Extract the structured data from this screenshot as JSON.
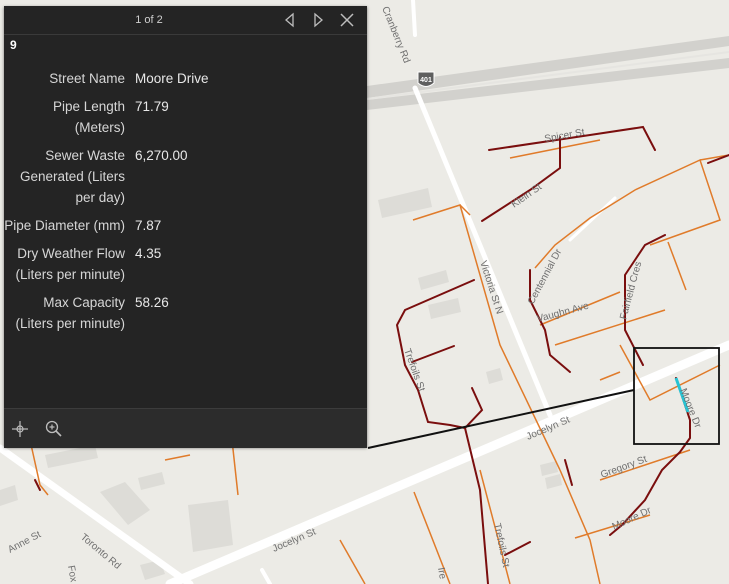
{
  "popup": {
    "pager_text": "1 of 2",
    "feature_id": "9",
    "attributes": [
      {
        "label": "Street Name",
        "value": "Moore Drive"
      },
      {
        "label": "Pipe Length (Meters)",
        "value": "71.79"
      },
      {
        "label": "Sewer Waste Generated (Liters per day)",
        "value": "6,270.00"
      },
      {
        "label": "Pipe Diameter (mm)",
        "value": "7.87"
      },
      {
        "label": "Dry Weather Flow (Liters per minute)",
        "value": "4.35"
      },
      {
        "label": "Max Capacity (Liters per minute)",
        "value": "58.26"
      }
    ],
    "header_icons": [
      "previous-icon",
      "next-icon",
      "close-icon"
    ],
    "footer_icons": [
      "pan-icon",
      "zoom-to-icon"
    ]
  },
  "map": {
    "highway_shield": "401",
    "street_labels": {
      "cranberry": "Cranberry Rd",
      "spicer": "Spicer St",
      "klein": "Klein St",
      "centennial": "Centennial Dr",
      "victoria": "Victoria St N",
      "vaughn": "Vaughn Ave",
      "fairfield": "Fairfield Cres",
      "trefoils_upper": "Trefoils St",
      "jocelyn_upper": "Jocelyn St",
      "moore_drive": "Moore Dr",
      "gregory": "Gregory St",
      "moore_lower": "Moore Dr",
      "jocelyn_lower": "Jocelyn St",
      "trefoils_lower": "Trefoils St",
      "anne": "Anne St",
      "toronto": "Toronto Rd",
      "fox": "Fox",
      "bottom_fragment": "Ire"
    },
    "colors": {
      "map_background": "#ecebe6",
      "road": "#ffffff",
      "highway": "#c8c8c4",
      "sewer_main_large": "#7a0e0e",
      "sewer_main_small": "#e07b2a",
      "selected_pipe": "#27c3d3",
      "selection_box": "#111111",
      "leader_line": "#111111"
    }
  }
}
